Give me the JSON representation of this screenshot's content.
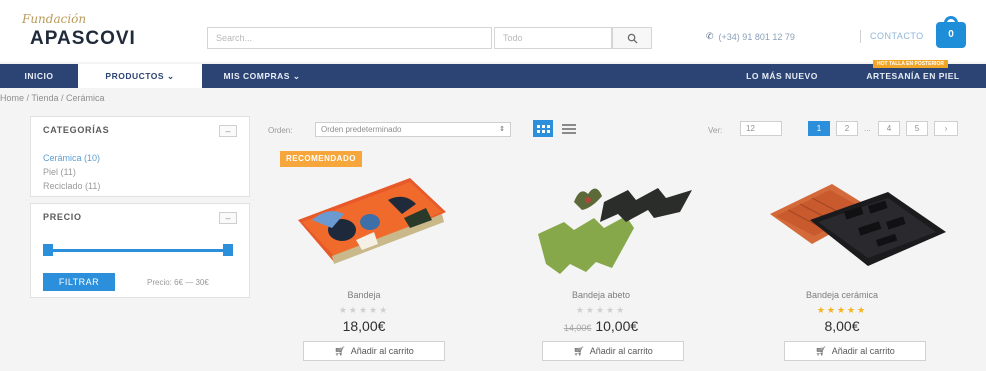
{
  "header": {
    "logo_script": "Fundación",
    "logo_main": "APASCOVI",
    "search_placeholder": "Search...",
    "category_select": "Todo",
    "phone": "(+34) 91 801 12 79",
    "contact": "CONTACTO",
    "cart_count": "0"
  },
  "nav": {
    "items": [
      "INICIO",
      "PRODUCTOS ⌄",
      "MIS COMPRAS ⌄",
      "LO MÁS NUEVO",
      "ARTESANÍA EN PIEL"
    ],
    "badge": "HOT TALLA EN POSTERIOR"
  },
  "breadcrumb": "Home  /  Tienda  /  Cerámica",
  "sidebar": {
    "categories_title": "CATEGORÍAS",
    "categories": [
      "Cerámica (10)",
      "Piel (11)",
      "Reciclado (11)"
    ],
    "price_title": "PRECIO",
    "filter_button": "FILTRAR",
    "price_range": "Precio: 6€ — 30€"
  },
  "toolbar": {
    "order_label": "Orden:",
    "order_value": "Orden predeterminado",
    "per_label": "Ver:",
    "per_value": "12",
    "pages": [
      "1",
      "2",
      "...",
      "4",
      "5",
      "›"
    ]
  },
  "products": [
    {
      "badge": "RECOMENDADO",
      "title": "Bandeja",
      "stars": "★★★★★",
      "rated": false,
      "old_price": "",
      "price": "18,00€",
      "button": "Añadir al carrito"
    },
    {
      "badge": "",
      "title": "Bandeja abeto",
      "stars": "★★★★★",
      "rated": false,
      "old_price": "14,00€",
      "price": "10,00€",
      "button": "Añadir al carrito"
    },
    {
      "badge": "",
      "title": "Bandeja cerámica",
      "stars": "★★★★★",
      "rated": true,
      "old_price": "",
      "price": "8,00€",
      "button": "Añadir al carrito"
    }
  ],
  "colors": {
    "nav": "#2c4473",
    "accent": "#2b8fdb",
    "badge": "#f6a63a",
    "star": "#f6b21c"
  }
}
